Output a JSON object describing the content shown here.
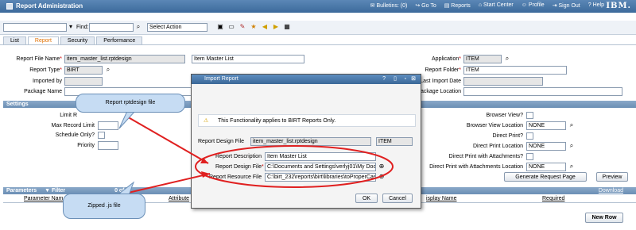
{
  "header": {
    "app_title": "Report Administration",
    "links": [
      {
        "icon": "bulletin-icon",
        "label": "Bulletins: (0)"
      },
      {
        "icon": "goto-icon",
        "label": "Go To"
      },
      {
        "icon": "reports-icon",
        "label": "Reports"
      },
      {
        "icon": "start-center-icon",
        "label": "Start Center"
      },
      {
        "icon": "profile-icon",
        "label": "Profile"
      },
      {
        "icon": "sign-out-icon",
        "label": "Sign Out"
      },
      {
        "icon": "help-icon",
        "label": "Help"
      }
    ],
    "brand": "IBM."
  },
  "toolbar": {
    "find_label": "Find:",
    "find_value": "",
    "select_action": "Select Action"
  },
  "tabs": [
    "List",
    "Report",
    "Security",
    "Performance"
  ],
  "report": {
    "file_name_label": "Report File Name",
    "file_name": "item_master_list.rptdesign",
    "description": "Item Master List",
    "type_label": "Report Type",
    "type": "BIRT",
    "imported_by_label": "Imported by",
    "package_name_label": "Package Name",
    "application_label": "Application",
    "application": "ITEM",
    "folder_label": "Report Folder",
    "folder": "ITEM",
    "last_import_label": "Last Import Date",
    "package_location_label": "Package Location"
  },
  "settings": {
    "title": "Settings",
    "limit_label": "Limit R",
    "max_record_label": "Max Record Limit",
    "schedule_only_label": "Schedule Only?",
    "priority_label": "Priority",
    "browser_view_label": "Browser View?",
    "browser_view_location_label": "Browser View Location",
    "browser_view_location": "NONE",
    "direct_print_label": "Direct Print?",
    "direct_print_location_label": "Direct Print Location",
    "direct_print_location": "NONE",
    "direct_print_attach_label": "Direct Print with Attachments?",
    "direct_print_attach_location_label": "Direct Print with Attachments Location",
    "direct_print_attach_location": "NONE",
    "generate_button": "Generate Request Page",
    "preview_button": "Preview"
  },
  "parameters": {
    "title": "Parameters",
    "filter_label": "Filter",
    "paging": "0 of 0",
    "download": "Download",
    "columns": [
      "Parameter Nam",
      "Attribute",
      "isplay Name",
      "Required"
    ],
    "new_row_button": "New Row"
  },
  "dialog": {
    "title": "Import Report",
    "info_text": "This Functionality applies to BIRT Reports Only.",
    "design_file_label": "Report Design File",
    "design_file_value": "item_master_list.rptdesign",
    "design_file_app": "ITEM",
    "report_description_label": "Report Description",
    "report_description": "Item Master List",
    "design_file_path_label": "Report Design File",
    "design_file_path": "C:\\Documents and Settings\\verlyj01\\My Docum",
    "resource_file_label": "Report Resource File",
    "resource_file_path": "C:\\birt_232\\reports\\birt\\libraries\\toProperCase.j",
    "ok_button": "OK",
    "cancel_button": "Cancel"
  },
  "callouts": {
    "rptdesign": "Report rptdesign file",
    "zipped": "Zipped .js file"
  },
  "colors": {
    "header": "#3c6a9b",
    "active_tab": "#e07000",
    "required": "#cc0000",
    "annotation": "#e02020",
    "callout_fill": "#c6dcf3"
  }
}
